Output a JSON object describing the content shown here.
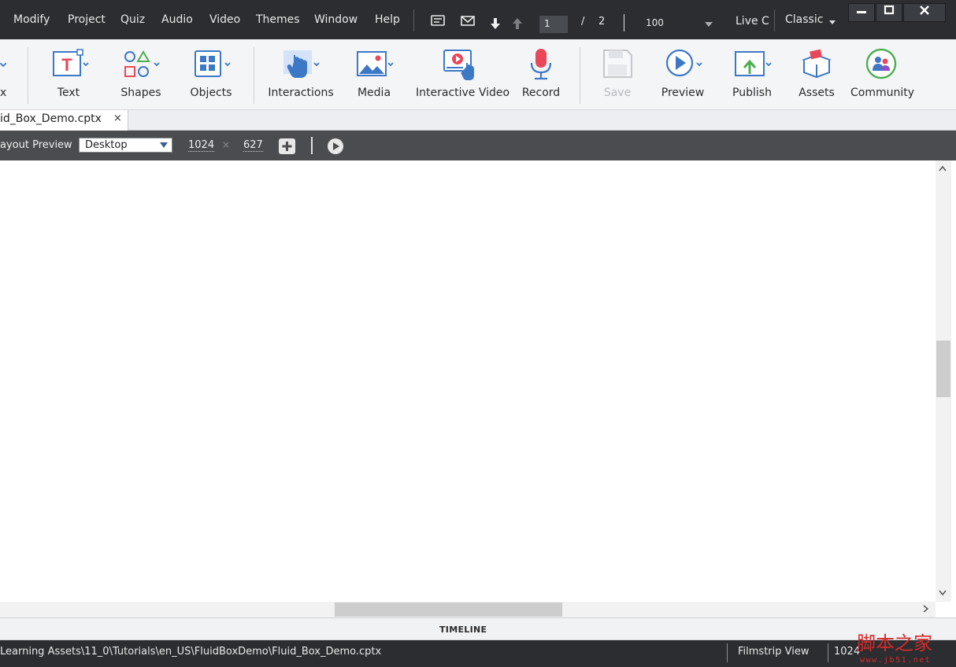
{
  "menubar": {
    "items": [
      "Modify",
      "Project",
      "Quiz",
      "Audio",
      "Video",
      "Themes",
      "Window",
      "Help"
    ],
    "page_current": "1",
    "page_separator": "/",
    "page_total": "2",
    "zoom": "100",
    "live_label": "Live C",
    "workspace": "Classic"
  },
  "toolbar": {
    "partial_label": "x",
    "tools": [
      "Text",
      "Shapes",
      "Objects",
      "Interactions",
      "Media",
      "Interactive Video",
      "Record",
      "Save",
      "Preview",
      "Publish",
      "Assets",
      "Community"
    ]
  },
  "tab": {
    "title": "id_Box_Demo.cptx",
    "close": "×"
  },
  "preview": {
    "label": "ayout Preview",
    "device": "Desktop",
    "width": "1024",
    "height": "627",
    "times": "×"
  },
  "timeline": {
    "label": "TIMELINE"
  },
  "status": {
    "path": "Learning Assets\\11_0\\Tutorials\\en_US\\FluidBoxDemo\\Fluid_Box_Demo.cptx",
    "view": "Filmstrip View",
    "resolution": "1024"
  },
  "watermark": {
    "cn": "脚本之家",
    "url": "www.jb51.net"
  },
  "colors": {
    "menubar_bg": "#2b2d30",
    "toolbar_bg": "#f4f5f7",
    "accent_blue": "#3d78c6",
    "record_red": "#e8485a",
    "publish_green": "#4caf50",
    "community_purple": "#8a4fc7"
  }
}
